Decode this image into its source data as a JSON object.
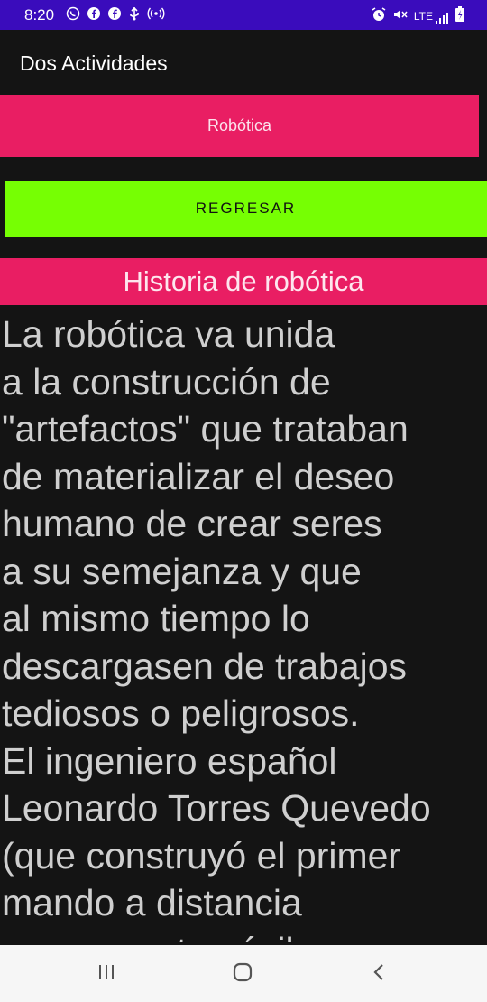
{
  "status_bar": {
    "time": "8:20",
    "left_icons": [
      "whatsapp-icon",
      "facebook-icon",
      "facebook-icon",
      "usb-icon",
      "hotspot-icon"
    ],
    "right_icons": [
      "alarm-icon",
      "mute-icon",
      "lte-signal-icon",
      "battery-icon"
    ],
    "network": "LTE",
    "color": "#3a0cbc"
  },
  "app_bar": {
    "title": "Dos Actividades"
  },
  "robotica_bar": {
    "label": "Robótica",
    "color": "#e91e63"
  },
  "regresar_button": {
    "label": "REGRESAR",
    "color": "#76ff03"
  },
  "section": {
    "heading": "Historia de robótica",
    "body_lines": [
      "La robótica va unida",
      "a la construcción de",
      "\"artefactos\" que trataban",
      "de materializar el deseo",
      "humano de crear seres",
      "a su semejanza y que",
      "al mismo tiempo lo",
      "descargasen de trabajos",
      "tediosos o peligrosos.",
      "El ingeniero español",
      "Leonardo Torres Quevedo",
      "(que construyó el primer",
      "mando a distancia",
      "para su automóvil"
    ]
  },
  "nav_bar": {
    "buttons": [
      "recent-apps-icon",
      "home-icon",
      "back-icon"
    ]
  }
}
